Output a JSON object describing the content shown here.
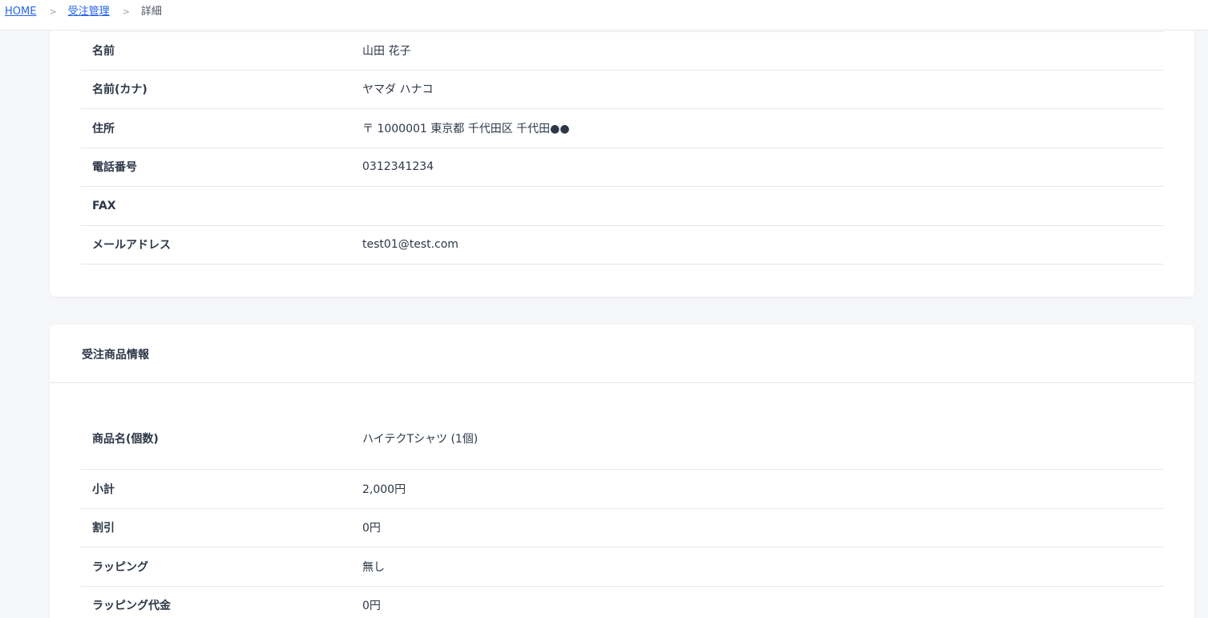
{
  "breadcrumb": {
    "home": "HOME",
    "separator": ">",
    "orders": "受注管理",
    "current": "詳細"
  },
  "customer_info": {
    "rows": [
      {
        "label": "名前",
        "value": "山田 花子"
      },
      {
        "label": "名前(カナ)",
        "value": "ヤマダ ハナコ"
      },
      {
        "label": "住所",
        "value": "〒 1000001 東京都 千代田区 千代田●●"
      },
      {
        "label": "電話番号",
        "value": "0312341234"
      },
      {
        "label": "FAX",
        "value": ""
      },
      {
        "label": "メールアドレス",
        "value": "test01@test.com"
      }
    ]
  },
  "order_items": {
    "title": "受注商品情報",
    "rows": [
      {
        "label": "商品名(個数)",
        "value": "ハイテクTシャツ (1個)"
      },
      {
        "label": "小計",
        "value": "2,000円"
      },
      {
        "label": "割引",
        "value": "0円"
      },
      {
        "label": "ラッピング",
        "value": "無し"
      },
      {
        "label": "ラッピング代金",
        "value": "0円"
      }
    ]
  },
  "colors": {
    "background": "#f6f7f9",
    "card": "#ffffff",
    "border": "#e5e7eb",
    "link": "#2563eb",
    "text": "#2d3748"
  }
}
